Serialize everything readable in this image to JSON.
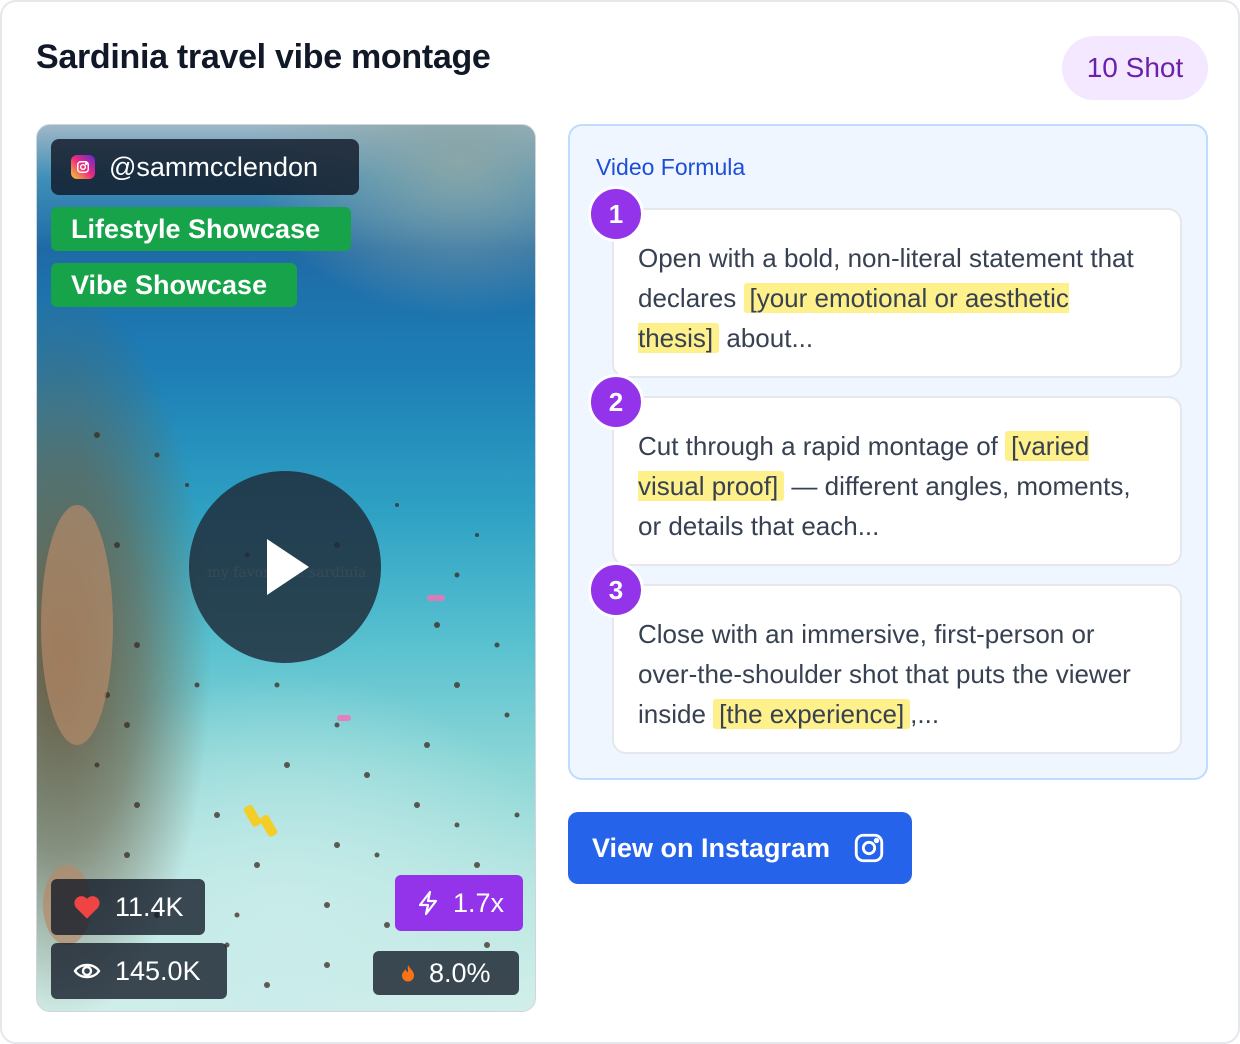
{
  "header": {
    "title": "Sardinia travel vibe montage",
    "badge": "10 Shot"
  },
  "video": {
    "handle": "@sammcclendon",
    "tags": [
      "Lifestyle Showcase",
      "Vibe Showcase"
    ],
    "caption_overlay": "my favorite      s: sardinia",
    "stats": {
      "likes": "11.4K",
      "views": "145.0K",
      "multiplier": "1.7x",
      "engagement": "8.0%"
    },
    "colors": {
      "tag": "#16a34a",
      "multiplier": "#9333ea",
      "heart": "#ef4444",
      "flame": "#f97316"
    }
  },
  "formula": {
    "label": "Video Formula",
    "steps": [
      {
        "number": "1",
        "before": "Open with a bold, non-literal statement that declares ",
        "highlight": "[your emotional or aesthetic thesis]",
        "after": " about..."
      },
      {
        "number": "2",
        "before": "Cut through a rapid montage of ",
        "highlight": "[varied visual proof]",
        "after": " — different angles, moments, or details that each..."
      },
      {
        "number": "3",
        "before": "Close with an immersive, first-person or over-the-shoulder shot that puts the viewer inside ",
        "highlight": "[the experience]",
        "after": ",..."
      }
    ]
  },
  "actions": {
    "instagram_button": "View on Instagram"
  },
  "icons": {
    "handle": "instagram-icon",
    "likes": "heart-icon",
    "views": "eye-icon",
    "multiplier": "lightning-icon",
    "engagement": "flame-icon",
    "play": "play-icon",
    "button": "instagram-icon"
  }
}
